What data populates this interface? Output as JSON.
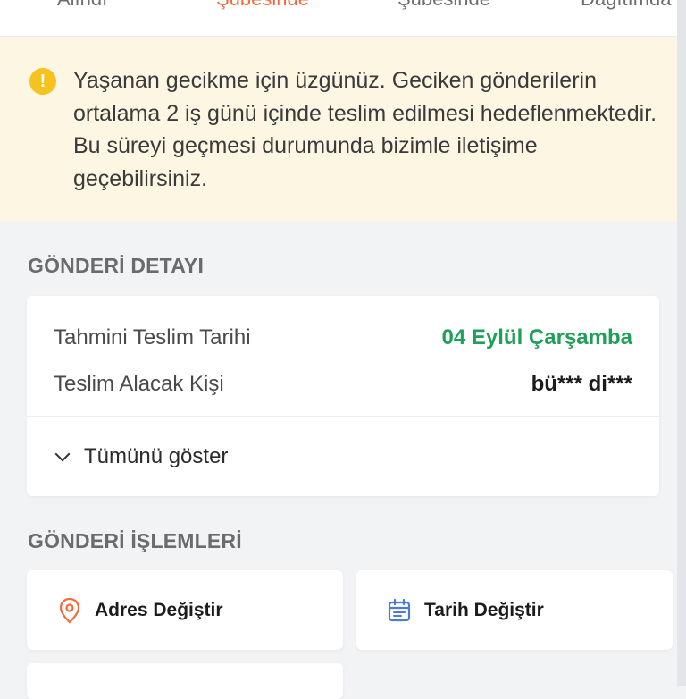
{
  "tabs": [
    {
      "label": "Alındı",
      "active": false
    },
    {
      "label": "Şubesinde",
      "active": true
    },
    {
      "label": "Şubesinde",
      "active": false
    },
    {
      "label": "Dağıtımda",
      "active": false
    }
  ],
  "notice": {
    "icon": "warning-circle-icon",
    "text": "Yaşanan gecikme için üzgünüz. Geciken gönderilerin ortalama 2 iş günü içinde teslim edilmesi hedeflenmektedir. Bu süreyi geçmesi durumunda bizimle iletişime geçebilirsiniz."
  },
  "detail": {
    "section_title": "GÖNDERİ DETAYI",
    "estimated_label": "Tahmini Teslim Tarihi",
    "estimated_value": "04 Eylül Çarşamba",
    "receiver_label": "Teslim Alacak Kişi",
    "receiver_value": "bü*** di***",
    "expand_label": "Tümünü göster"
  },
  "actions": {
    "section_title": "GÖNDERİ İŞLEMLERİ",
    "items": [
      {
        "label": "Adres Değiştir",
        "icon": "location-pin-icon"
      },
      {
        "label": "Tarih Değiştir",
        "icon": "calendar-icon"
      }
    ]
  },
  "colors": {
    "accent": "#f26b3a",
    "success": "#1fa058",
    "warning": "#f6c21f",
    "calendar": "#4a7bd6",
    "notice_bg": "#fdf6e3"
  }
}
